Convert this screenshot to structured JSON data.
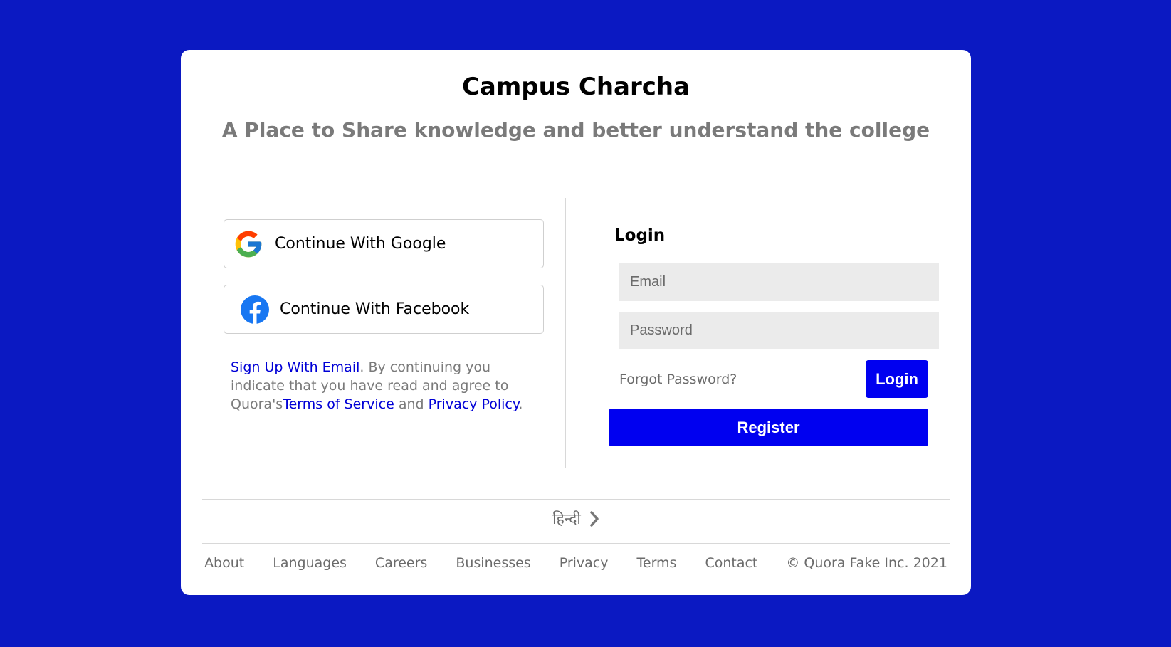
{
  "brand": {
    "title": "Campus Charcha",
    "tagline": "A Place to Share knowledge and better understand the college"
  },
  "social": {
    "google_label": "Continue With Google",
    "facebook_label": "Continue With Facebook"
  },
  "terms": {
    "signup_link": "Sign Up With Email",
    "text_1": ". By continuing you indicate that you have read and agree to Quora's",
    "terms_link": "Terms of Service",
    "text_2": " and ",
    "privacy_link": "Privacy Policy",
    "text_3": "."
  },
  "login": {
    "title": "Login",
    "email_placeholder": "Email",
    "password_placeholder": "Password",
    "forgot_label": "Forgot Password?",
    "login_button": "Login",
    "register_button": "Register"
  },
  "language": {
    "label": "हिन्दी"
  },
  "footer": {
    "links": [
      "About",
      "Languages",
      "Careers",
      "Businesses",
      "Privacy",
      "Terms",
      "Contact"
    ],
    "copyright": "© Quora Fake Inc. 2021"
  },
  "colors": {
    "background": "#0b19c2",
    "primary_button": "#0000f0",
    "link": "#0000d6",
    "muted_text": "#7a7a7a"
  },
  "icons": {
    "google": "google-logo-icon",
    "facebook": "facebook-logo-icon",
    "chevron": "chevron-right-icon"
  }
}
